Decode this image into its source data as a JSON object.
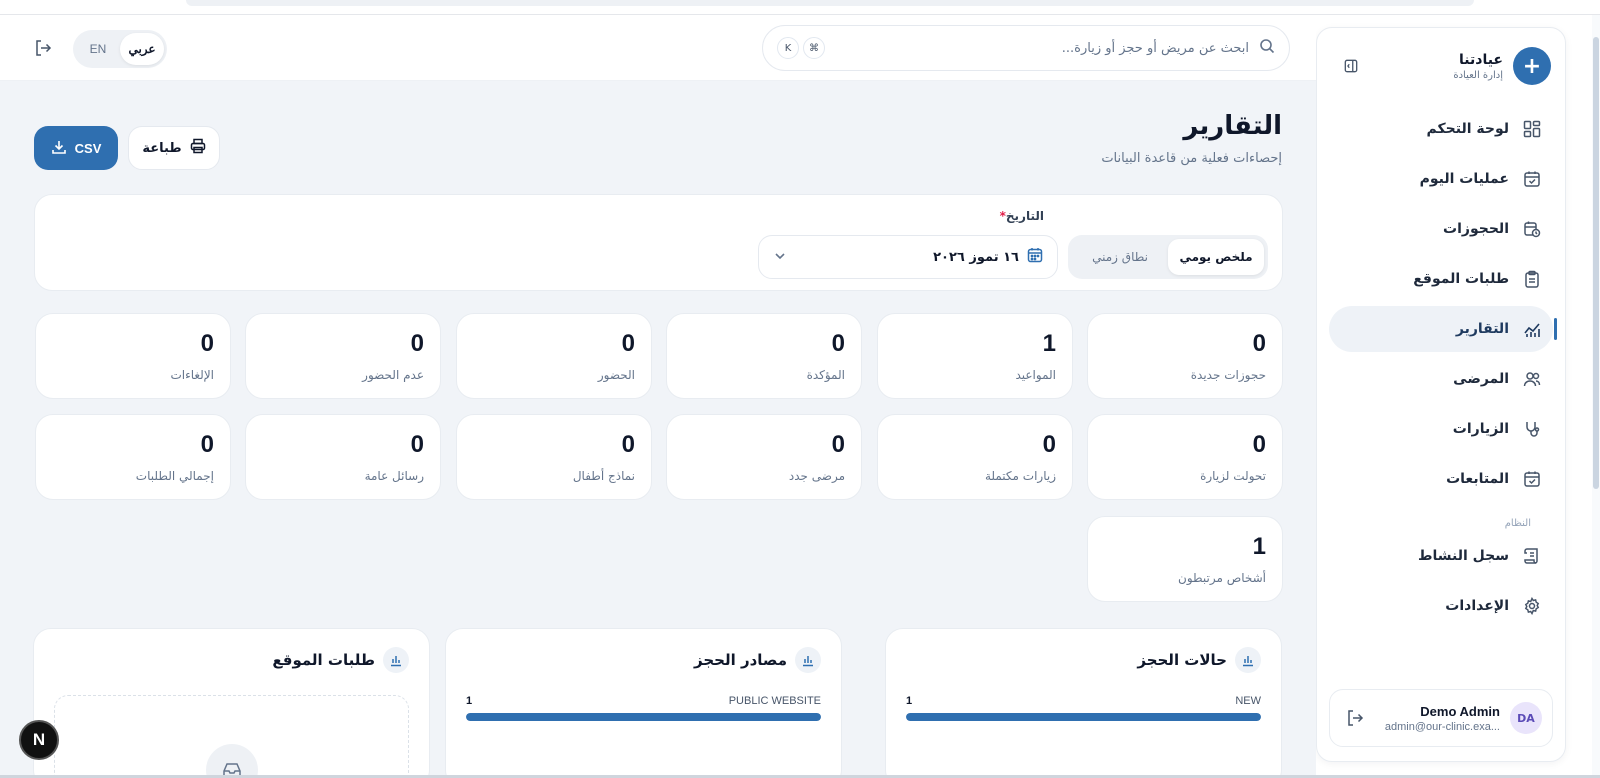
{
  "brand": {
    "name": "عيادتنا",
    "subtitle": "إدارة العيادة"
  },
  "sidebar": {
    "items": [
      {
        "label": "لوحة التحكم",
        "icon": "dashboard-icon"
      },
      {
        "label": "عمليات اليوم",
        "icon": "calendar-check-icon"
      },
      {
        "label": "الحجوزات",
        "icon": "calendar-clock-icon"
      },
      {
        "label": "طلبات الموقع",
        "icon": "clipboard-icon"
      },
      {
        "label": "التقارير",
        "icon": "chart-icon",
        "active": true
      },
      {
        "label": "المرضى",
        "icon": "users-icon"
      },
      {
        "label": "الزيارات",
        "icon": "stethoscope-icon"
      },
      {
        "label": "المتابعات",
        "icon": "calendar-check-icon"
      }
    ],
    "system_section": "النظام",
    "system_items": [
      {
        "label": "سجل النشاط",
        "icon": "scroll-icon"
      },
      {
        "label": "الإعدادات",
        "icon": "gear-icon"
      }
    ]
  },
  "user": {
    "initials": "DA",
    "name": "Demo Admin",
    "email": "admin@our-clinic.exa..."
  },
  "header": {
    "search_placeholder": "ابحث عن مريض أو حجز أو زيارة...",
    "kbd_cmd": "⌘",
    "kbd_k": "K",
    "lang_ar": "عربي",
    "lang_en": "EN"
  },
  "page": {
    "title": "التقارير",
    "subtitle": "إحصاءات فعلية من قاعدة البيانات",
    "print_label": "طباعة",
    "csv_label": "CSV"
  },
  "filter": {
    "date_label": "التاريخ",
    "required_mark": "*",
    "mode_daily": "ملخص يومي",
    "mode_range": "نطاق زمني",
    "date_value": "١٦ تموز ٢٠٢٦"
  },
  "stats": [
    {
      "value": "0",
      "label": "حجوزات جديدة"
    },
    {
      "value": "1",
      "label": "المواعيد"
    },
    {
      "value": "0",
      "label": "المؤكدة"
    },
    {
      "value": "0",
      "label": "الحضور"
    },
    {
      "value": "0",
      "label": "عدم الحضور"
    },
    {
      "value": "0",
      "label": "الإلغاءات"
    },
    {
      "value": "0",
      "label": "تحولت لزيارة"
    },
    {
      "value": "0",
      "label": "زيارات مكتملة"
    },
    {
      "value": "0",
      "label": "مرضى جدد"
    },
    {
      "value": "0",
      "label": "نماذج أطفال"
    },
    {
      "value": "0",
      "label": "رسائل عامة"
    },
    {
      "value": "0",
      "label": "إجمالي الطلبات"
    },
    {
      "value": "1",
      "label": "أشخاص مرتبطون"
    }
  ],
  "charts": [
    {
      "title": "حالات الحجز",
      "bar_label": "NEW",
      "bar_count": "1",
      "fill_fraction": 1.0
    },
    {
      "title": "مصادر الحجز",
      "bar_label": "PUBLIC WEBSITE",
      "bar_count": "1",
      "fill_fraction": 1.0
    },
    {
      "title": "طلبات الموقع"
    }
  ],
  "dev_badge": "N",
  "colors": {
    "accent": "#2f6fb0",
    "background": "#f1f4f8",
    "card": "#ffffff"
  }
}
